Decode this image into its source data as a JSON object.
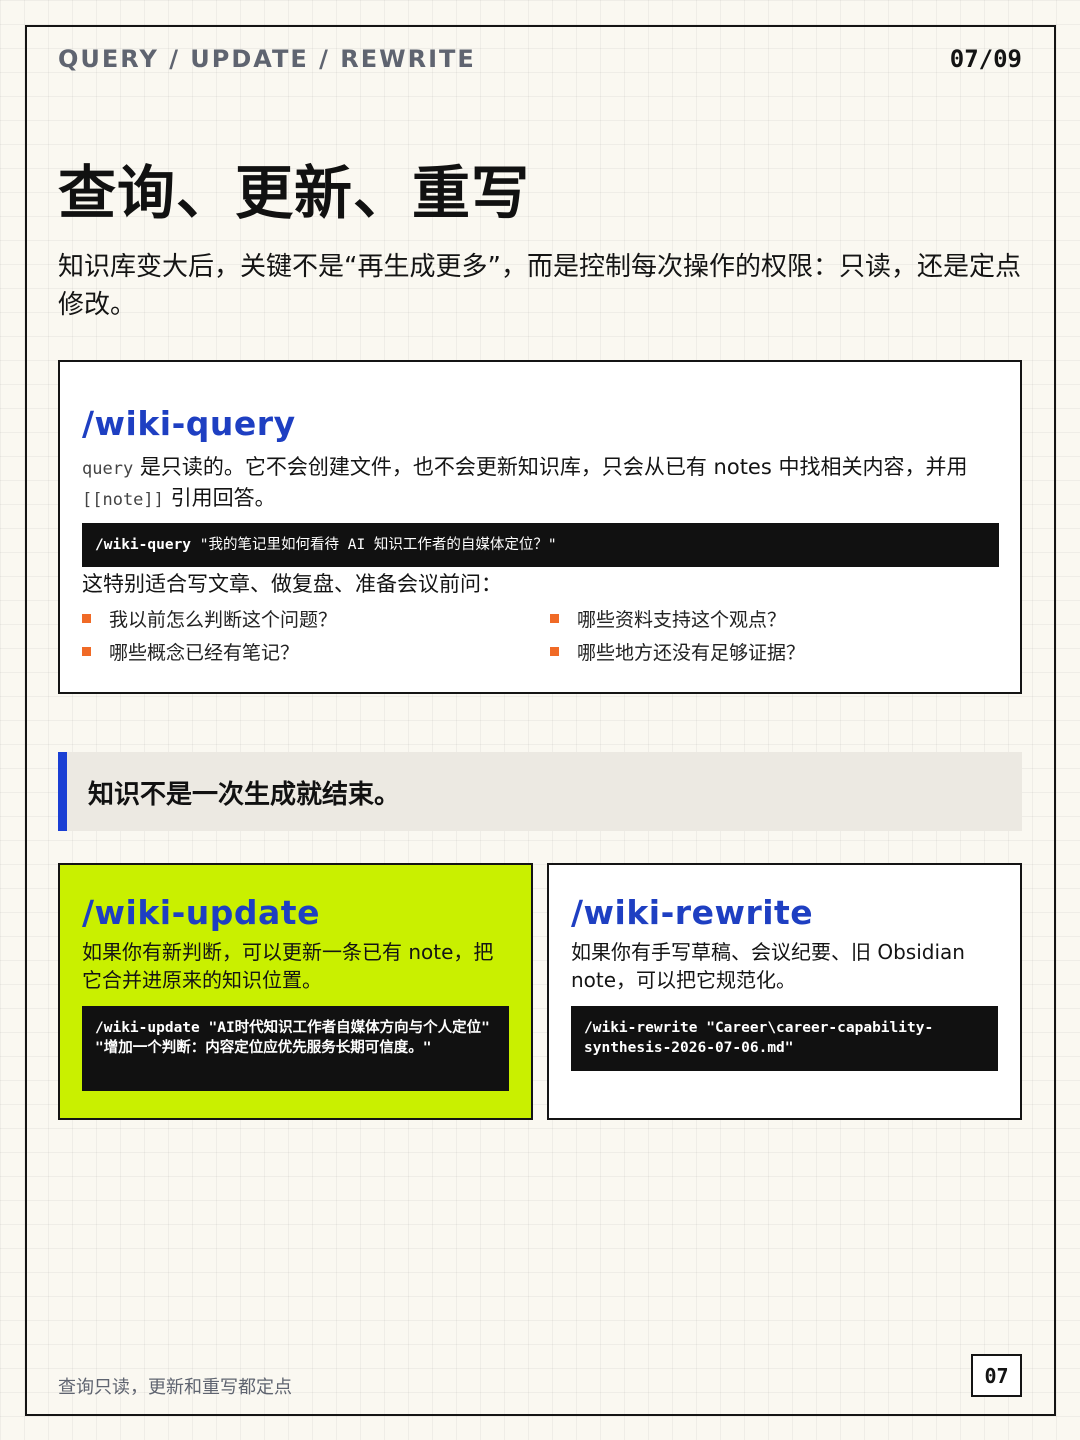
{
  "header": {
    "section": "QUERY / UPDATE / REWRITE",
    "page_indicator": "07/09"
  },
  "title": "查询、更新、重写",
  "intro": "知识库变大后，关键不是“再生成更多”，而是控制每次操作的权限：只读，还是定点修改。",
  "query_card": {
    "command": "/wiki-query",
    "desc_code": "query",
    "desc_text_1": " 是只读的。它不会创建文件，也不会更新知识库，只会从已有 notes 中找相关内容，并用 ",
    "desc_code_2": "[[note]]",
    "desc_text_2": " 引用回答。",
    "example_cmd": "/wiki-query",
    "example_arg": " \"我的笔记里如何看待 AI 知识工作者的自媒体定位？\"",
    "suits_label": "这特别适合写文章、做复盘、准备会议前问：",
    "questions": [
      "我以前怎么判断这个问题？",
      "哪些资料支持这个观点？",
      "哪些概念已经有笔记？",
      "哪些地方还没有足够证据？"
    ],
    "bullet_color": "#f06a26"
  },
  "callout": {
    "text": "知识不是一次生成就结束。",
    "accent_color": "#1a3fd4"
  },
  "update_card": {
    "command": "/wiki-update",
    "desc": "如果你有新判断，可以更新一条已有 note，把它合并进原来的知识位置。",
    "example": "/wiki-update \"AI时代知识工作者自媒体方向与个人定位\" \"增加一个判断：内容定位应优先服务长期可信度。\"",
    "bg_color": "#c9f000"
  },
  "rewrite_card": {
    "command": "/wiki-rewrite",
    "desc": "如果你有手写草稿、会议纪要、旧 Obsidian note，可以把它规范化。",
    "example": "/wiki-rewrite \"Career\\career-capability-synthesis-2026-07-06.md\""
  },
  "footer": {
    "caption": "查询只读，更新和重写都定点",
    "page_number": "07"
  },
  "colors": {
    "accent_blue": "#1e3fc2",
    "background": "#faf8f1"
  }
}
